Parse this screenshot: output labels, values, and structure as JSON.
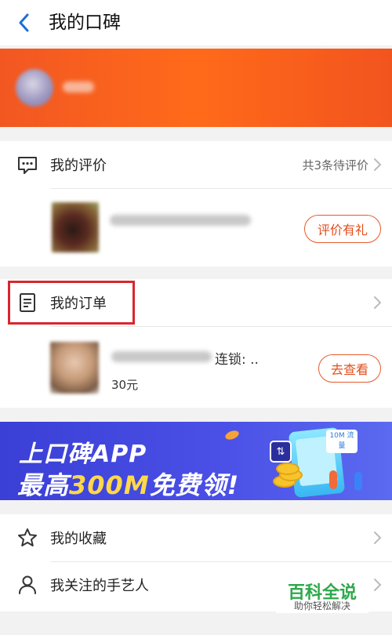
{
  "header": {
    "title": "我的口碑",
    "back_icon": "back-chevron-icon"
  },
  "colors": {
    "accent_orange": "#f25722",
    "button_border": "#e85a2a",
    "highlight_red": "#d9262e",
    "promo_blue": "#3a3fd6",
    "watermark_green": "#2ea84a"
  },
  "reviews": {
    "label": "我的评价",
    "pending_text": "共3条待评价",
    "item_button": "评价有礼"
  },
  "orders": {
    "label": "我的订单",
    "item_name_suffix": "连锁: ..",
    "item_price": "30元",
    "item_button": "去查看"
  },
  "promo": {
    "line1": "上口碑APP",
    "line2_prefix": "最高",
    "line2_highlight": "300M",
    "line2_suffix": "免费领!",
    "tag": "10M 流量"
  },
  "favorites": {
    "label": "我的收藏"
  },
  "artisans": {
    "label": "我关注的手艺人"
  },
  "watermark": {
    "title": "百科全说",
    "subtitle": "助你轻松解决"
  }
}
